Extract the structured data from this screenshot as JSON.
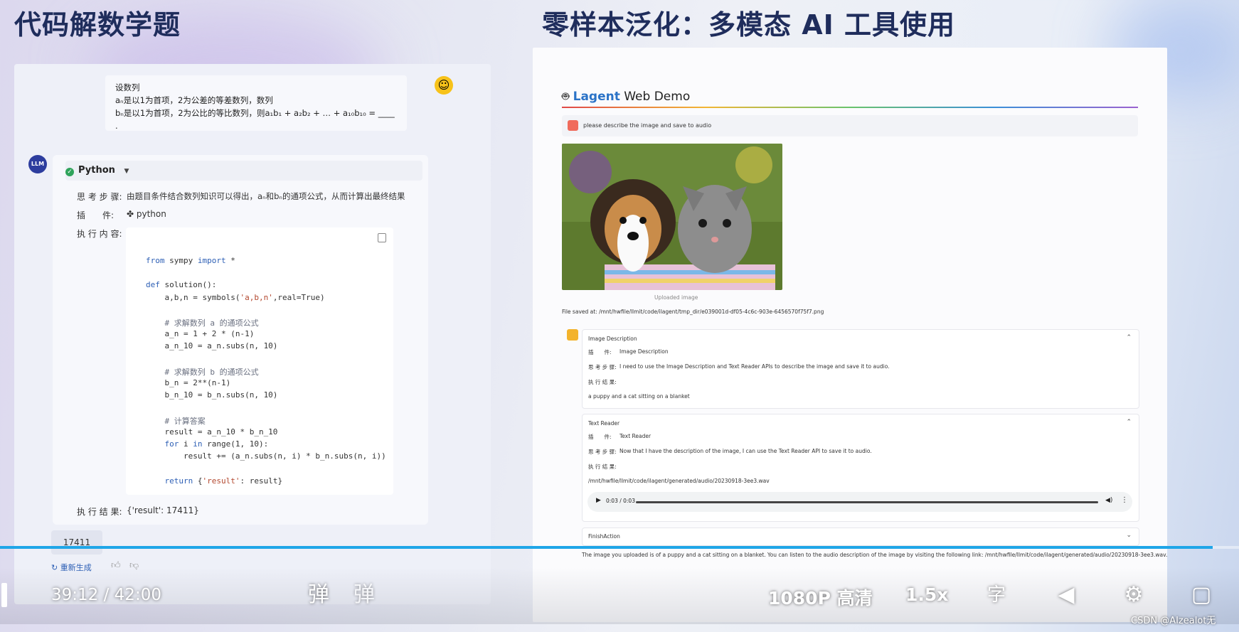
{
  "titles": {
    "left": "代码解数学题",
    "right": "零样本泛化：多模态 AI 工具使用"
  },
  "question": {
    "line1": "设数列",
    "line2": "aₙ是以1为首项，2为公差的等差数列，数列",
    "line3": "bₙ是以1为首项，2为公比的等比数列，则a₁b₁ + a₂b₂ + … + a₁₀b₁₀ = ____ ."
  },
  "llm_avatar": "LLM",
  "response": {
    "plugin_header": "Python",
    "thought_label": "思 考 步 骤:",
    "thought_text": "由题目条件结合数列知识可以得出，aₙ和bₙ的通项公式，从而计算出最终结果",
    "plugin_label": "插　　件:",
    "plugin_value": "python",
    "exec_label": "执 行 内 容:",
    "code_lines": [
      {
        "k": "from",
        "t": " sympy ",
        "k2": "import",
        "r": " *"
      },
      {
        "t": ""
      },
      {
        "k": "def",
        "t": " solution():"
      },
      {
        "t": "    a,b,n = symbols('a,b,n',real=True)"
      },
      {
        "t": ""
      },
      {
        "t": "    # 求解数列 a 的通项公式"
      },
      {
        "t": "    a_n = 1 + 2 * (n-1)"
      },
      {
        "t": "    a_n_10 = a_n.subs(n, 10)"
      },
      {
        "t": ""
      },
      {
        "t": "    # 求解数列 b 的通项公式"
      },
      {
        "t": "    b_n = 2**(n-1)"
      },
      {
        "t": "    b_n_10 = b_n.subs(n, 10)"
      },
      {
        "t": ""
      },
      {
        "t": "    # 计算答案"
      },
      {
        "t": "    result = a_n_10 * b_n_10"
      },
      {
        "t": "    for i in range(1, 10):"
      },
      {
        "t": "        result += (a_n.subs(n, i) * b_n.subs(n, i))"
      },
      {
        "t": ""
      },
      {
        "t": "    return {'result': result}"
      }
    ],
    "result_label": "执 行 结 果:",
    "result_value": "{'result': 17411}",
    "answer": "17411",
    "regen": "重新生成"
  },
  "demo": {
    "title_brand": "Lagent",
    "title_rest": " Web Demo",
    "prompt": "please describe the image and save to audio",
    "image_caption": "Uploaded image",
    "file_saved": "File saved at: /mnt/hwfile/llmit/code/ilagent/tmp_dir/e039001d-df05-4c6c-903e-6456570f75f7.png",
    "card1": {
      "header": "Image Description",
      "plugin_label": "插　　件:",
      "plugin_value": "Image Description",
      "thought_label": "思 考 步 骤:",
      "thought": "I need to use the Image Description and Text Reader APIs to describe the image and save it to audio.",
      "result_label": "执 行 结 果:",
      "result": "a puppy and a cat sitting on a blanket"
    },
    "card2": {
      "header": "Text Reader",
      "plugin_label": "插　　件:",
      "plugin_value": "Text Reader",
      "thought_label": "思 考 步 骤:",
      "thought": "Now that I have the description of the image, I can use the Text Reader API to save it to audio.",
      "result_label": "执 行 结 果:",
      "result": "/mnt/hwfile/llmit/code/ilagent/generated/audio/20230918-3ee3.wav",
      "audio_time": "0:03 / 0:03"
    },
    "card3": {
      "header": "FinishAction"
    },
    "final": "The image you uploaded is of a puppy and a cat sitting on a blanket. You can listen to the audio description of the image by visiting the following link: /mnt/hwfile/llmit/code/ilagent/generated/audio/20230918-3ee3.wav."
  },
  "player": {
    "current": "39:12",
    "sep": "/",
    "total": "42:00",
    "quality": "1080P 高清",
    "speed": "1.5x",
    "progress": 0.979,
    "accent": "#1fa6e8"
  },
  "watermark": "CSDN @AIzealot无"
}
